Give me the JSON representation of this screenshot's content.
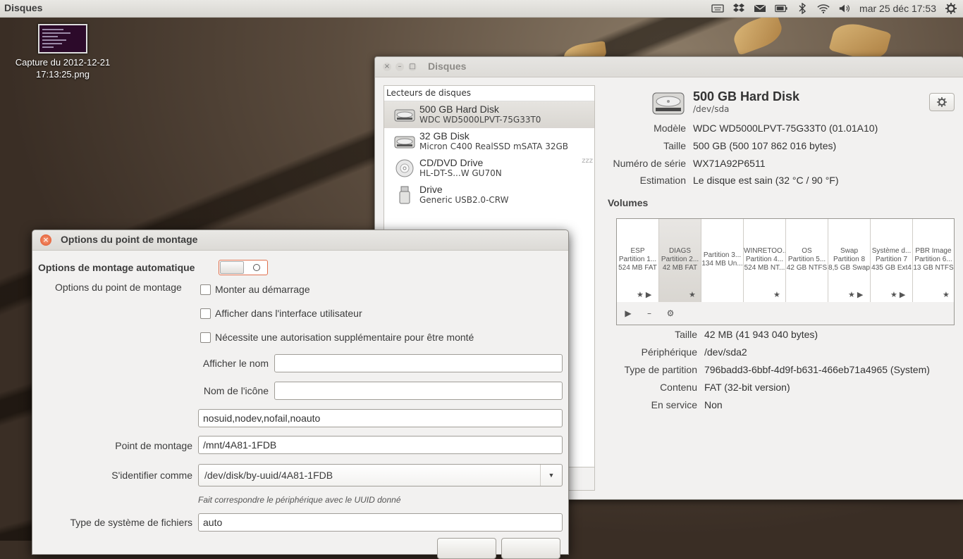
{
  "top_panel": {
    "app_name": "Disques",
    "clock": "mar 25 déc  17:53",
    "indicators": [
      "keyboard-icon",
      "dropbox-icon",
      "mail-icon",
      "battery-icon",
      "bluetooth-icon",
      "wifi-icon",
      "volume-icon",
      "session-gear-icon"
    ]
  },
  "desktop": {
    "icon_label": "Capture du 2012-12-21 17:13:25.png"
  },
  "main_window": {
    "title": "Disques",
    "drives_header": "Lecteurs de disques",
    "drives": [
      {
        "name": "500 GB Hard Disk",
        "model": "WDC WD5000LPVT-75G33T0",
        "icon": "hard-disk-icon",
        "selected": true
      },
      {
        "name": "32 GB Disk",
        "model": "Micron C400 RealSSD mSATA 32GB",
        "icon": "hard-disk-icon",
        "selected": false
      },
      {
        "name": "CD/DVD Drive",
        "model": "HL-DT-S...W GU70N",
        "icon": "optical-disc-icon",
        "selected": false,
        "sleep": "zzz"
      },
      {
        "name": "Drive",
        "model": "Generic USB2.0-CRW",
        "icon": "usb-drive-icon",
        "selected": false
      }
    ],
    "disk": {
      "title": "500 GB Hard Disk",
      "device": "/dev/sda",
      "fields": [
        {
          "label": "Modèle",
          "value": "WDC WD5000LPVT-75G33T0 (01.01A10)"
        },
        {
          "label": "Taille",
          "value": "500 GB (500 107 862 016 bytes)"
        },
        {
          "label": "Numéro de série",
          "value": "WX71A92P6511"
        },
        {
          "label": "Estimation",
          "value": "Le disque est sain (32 °C / 90 °F)"
        }
      ]
    },
    "volumes_title": "Volumes",
    "volumes": [
      {
        "name": "ESP",
        "part": "Partition 1...",
        "info": "524 MB FAT",
        "icons": "★ ▶",
        "selected": false
      },
      {
        "name": "DIAGS",
        "part": "Partition 2...",
        "info": "42 MB FAT",
        "icons": "★",
        "selected": true
      },
      {
        "name": "",
        "part": "Partition 3...",
        "info": "134 MB Un...",
        "icons": "",
        "selected": false
      },
      {
        "name": "WINRETOO...",
        "part": "Partition 4...",
        "info": "524 MB NT...",
        "icons": "★",
        "selected": false
      },
      {
        "name": "OS",
        "part": "Partition 5...",
        "info": "42 GB NTFS",
        "icons": "",
        "selected": false
      },
      {
        "name": "Swap",
        "part": "Partition 8",
        "info": "8,5 GB Swap",
        "icons": "★ ▶",
        "selected": false
      },
      {
        "name": "Système d...",
        "part": "Partition 7",
        "info": "435 GB Ext4",
        "icons": "★ ▶",
        "selected": false
      },
      {
        "name": "PBR Image",
        "part": "Partition 6...",
        "info": "13 GB NTFS",
        "icons": "★",
        "selected": false
      }
    ],
    "volume_toolbar": {
      "play": "▶",
      "minus": "–",
      "gear": "⚙"
    },
    "partition_fields": [
      {
        "label": "Taille",
        "value": "42 MB (41 943 040 bytes)"
      },
      {
        "label": "Périphérique",
        "value": "/dev/sda2"
      },
      {
        "label": "Type de partition",
        "value": "796badd3-6bbf-4d9f-b631-466eb71a4965 (System)"
      },
      {
        "label": "Contenu",
        "value": "FAT (32-bit version)"
      },
      {
        "label": "En service",
        "value": "Non"
      }
    ]
  },
  "dialog": {
    "title": "Options du point de montage",
    "auto_label": "Options de montage automatique",
    "auto_state": "off",
    "section_label": "Options du point de montage",
    "checkboxes": [
      {
        "label": "Monter au démarrage",
        "checked": false
      },
      {
        "label": "Afficher dans l'interface utilisateur",
        "checked": false
      },
      {
        "label": "Nécessite une autorisation supplémentaire pour être monté",
        "checked": false
      }
    ],
    "display_name_label": "Afficher le nom",
    "display_name_value": "",
    "icon_name_label": "Nom de l'icône",
    "icon_name_value": "",
    "options_value": "nosuid,nodev,nofail,noauto",
    "mount_point_label": "Point de montage",
    "mount_point_value": "/mnt/4A81-1FDB",
    "identify_label": "S'identifier comme",
    "identify_value": "/dev/disk/by-uuid/4A81-1FDB",
    "identify_hint": "Fait correspondre le périphérique avec le UUID donné",
    "fs_type_label": "Type de système de fichiers",
    "fs_type_value": "auto"
  }
}
